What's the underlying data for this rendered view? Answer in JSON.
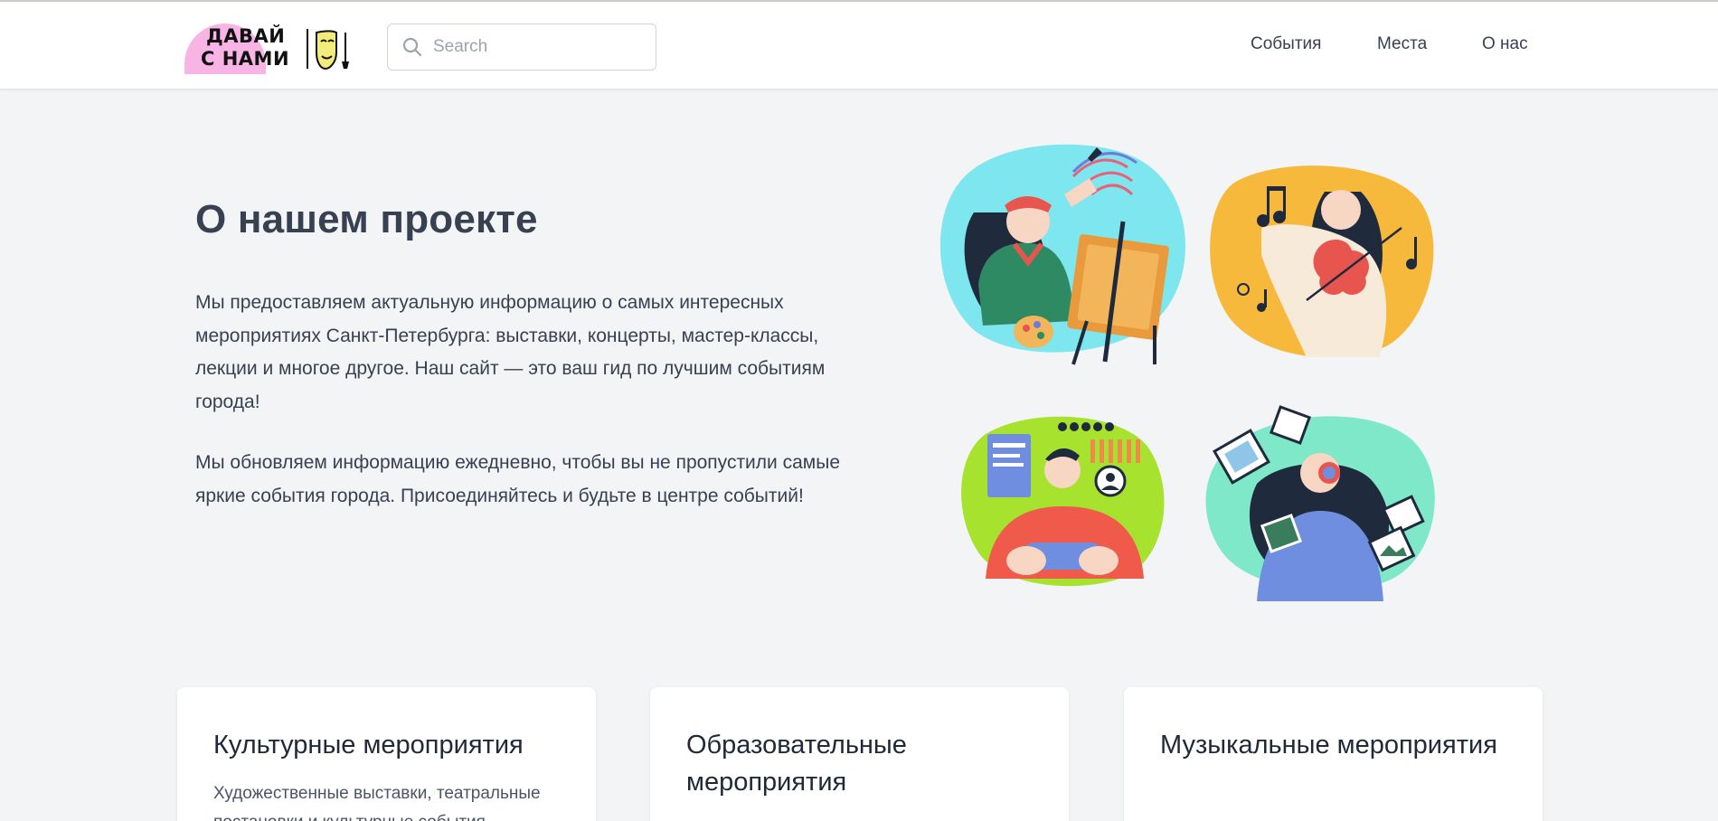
{
  "header": {
    "logo_line1": "ДАВАЙ",
    "logo_line2": "С НАМИ",
    "search_placeholder": "Search",
    "nav": [
      {
        "label": "События"
      },
      {
        "label": "Места"
      },
      {
        "label": "О нас"
      }
    ]
  },
  "about": {
    "title": "О нашем проекте",
    "paragraph1": "Мы предоставляем актуальную информацию о самых интересных мероприятиях Санкт-Петербурга: выставки, концерты, мастер-классы, лекции и многое другое. Наш сайт — это ваш гид по лучшим событиям города!",
    "paragraph2": "Мы обновляем информацию ежедневно, чтобы вы не пропустили самые яркие события города. Присоединяйтесь и будьте в центре событий!"
  },
  "cards": [
    {
      "title": "Культурные мероприятия",
      "description": "Художественные выставки, театральные постановки и культурные события"
    },
    {
      "title": "Образовательные мероприятия",
      "description": ""
    },
    {
      "title": "Музыкальные мероприятия",
      "description": ""
    }
  ],
  "colors": {
    "background": "#f3f4f6",
    "logo_pink": "#f9b4e6",
    "logo_yellow": "#f2ec7a",
    "text": "#374151"
  },
  "icons": [
    "search-icon",
    "theater-mask-icon",
    "brush-icon"
  ]
}
